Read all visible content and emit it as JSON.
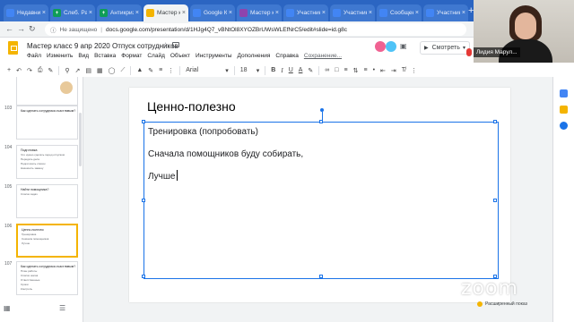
{
  "browser": {
    "tabs": [
      {
        "title": "Недавние",
        "fav": "#4285f4",
        "glyph": "",
        "active": false
      },
      {
        "title": "Слеб. Расп",
        "fav": "#0f9d58",
        "glyph": "+",
        "active": false
      },
      {
        "title": "Антикриз",
        "fav": "#0f9d58",
        "glyph": "+",
        "active": false
      },
      {
        "title": "Мастер к",
        "fav": "#f4b400",
        "glyph": "",
        "active": true
      },
      {
        "title": "Google Ка",
        "fav": "#4285f4",
        "glyph": "",
        "active": false
      },
      {
        "title": "Мастер к",
        "fav": "#8e44ad",
        "glyph": "",
        "active": false
      },
      {
        "title": "Участник",
        "fav": "#4285f4",
        "glyph": "",
        "active": false
      },
      {
        "title": "Участник",
        "fav": "#4285f4",
        "glyph": "",
        "active": false
      },
      {
        "title": "Сообщени",
        "fav": "#4285f4",
        "glyph": "",
        "active": false
      },
      {
        "title": "Участник",
        "fav": "#4285f4",
        "glyph": "",
        "active": false
      }
    ],
    "new_tab": "+",
    "secure_label": "Не защищено",
    "url": "docs.google.com/presentation/d/1HJg4Q7_vBNtOl8XYOZBrUWsWLEfNrC5/edit#slide=id.g8c"
  },
  "doc": {
    "title": "Мастер класс 9 апр 2020 Отпуск сотрудников",
    "menu": [
      "Файл",
      "Изменить",
      "Вид",
      "Вставка",
      "Формат",
      "Слайд",
      "Объект",
      "Инструменты",
      "Дополнения",
      "Справка"
    ],
    "saved": "Сохранение...",
    "present_label": "Смотреть",
    "comment_icon": "comment-icon"
  },
  "toolbar": {
    "font": "Arial",
    "size": "18",
    "bold": "B",
    "italic": "I",
    "underline": "U",
    "color": "A"
  },
  "slides": [
    {
      "num": "",
      "lines": [
        "",
        "",
        "",
        ""
      ]
    },
    {
      "num": "103",
      "lines": [
        "Как сделать сотрудника счастливым?"
      ]
    },
    {
      "num": "104",
      "lines": [
        "Подготовка",
        "Что нужно сделать перед отпуском",
        "Передать дела",
        "Подготовить список",
        "Назначить замену"
      ]
    },
    {
      "num": "105",
      "lines": [
        "Найти помощника?",
        "Список задач"
      ]
    },
    {
      "num": "106",
      "lines": [
        "Ценно-полезно",
        "Тренировка",
        "Сначала помощников",
        "Лучше"
      ]
    },
    {
      "num": "107",
      "lines": [
        "Как сделать сотрудника счастливым?",
        "План работы",
        "Список шагов",
        "Ответственные",
        "Сроки",
        "Контроль"
      ]
    }
  ],
  "slide": {
    "title": "Ценно-полезно",
    "lines": [
      "Тренировка (попробовать)",
      "Сначала помощников буду собирать,",
      "Лучше"
    ]
  },
  "zoom": {
    "participant": "Лидия Марул...",
    "watermark": "zoom",
    "notes_toggle": "Расширенный показ"
  }
}
